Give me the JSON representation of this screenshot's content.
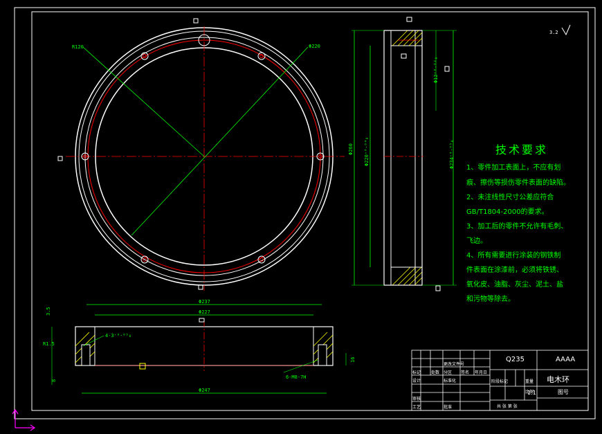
{
  "drawing": {
    "radius_label": "R120",
    "pcd_label": "Φ220",
    "roughness_mark": "3.2",
    "section_dims": {
      "overall_height": "Φ260",
      "inner_dia": "Φ220⁺⁰·⁰⁴₀",
      "outer_dia": "Φ234⁺⁰·⁰⁵₀",
      "bolt_hole": "Φ12⁺⁰·⁰²₀"
    },
    "bottom_dims": {
      "d1": "Φ237",
      "d2": "Φ227",
      "d3": "Φ247",
      "h1": "3.5",
      "h2": "16",
      "h3": "8",
      "r": "R1.5",
      "hole_note": "4-3⁺⁰·⁰⁵₀",
      "thread_note": "6-M8-7H"
    }
  },
  "tech_requirements": {
    "title": "技术要求",
    "items": [
      "1、零件加工表面上，不应有划",
      "痕、擦伤等损伤零件表面的缺陷。",
      "2、未注线性尺寸公差应符合",
      "GB/T1804-2000的要求。",
      "3、加工后的零件不允许有毛刺、",
      "飞边。",
      "4、所有需要进行涂装的钢铁制",
      "件表面在涂漆前，必须将铁锈、",
      "氧化皮、油脂、灰尘、泥土、盐",
      "和污物等除去。"
    ]
  },
  "title_block": {
    "material": "Q235",
    "code": "AAAA",
    "part_name": "电木环",
    "scale": "1:1",
    "sheet_label": "图号",
    "row_labels": [
      "标记",
      "处数",
      "分区",
      "更改文件号",
      "签名",
      "年月日"
    ],
    "design_label": "设计",
    "check_label": "审核",
    "process_label": "工艺",
    "approve_label": "批准",
    "stage_label": "阶段标记",
    "weight_label": "重量",
    "ratio_label": "比例",
    "std_label": "标准化",
    "sheet_count": "共 张 第 张"
  },
  "colors": {
    "outline": "#ffffff",
    "centerline": "#ff0000",
    "dimension": "#00ff00",
    "hatch": "#ffff00",
    "ucs": "#ff00ff"
  }
}
